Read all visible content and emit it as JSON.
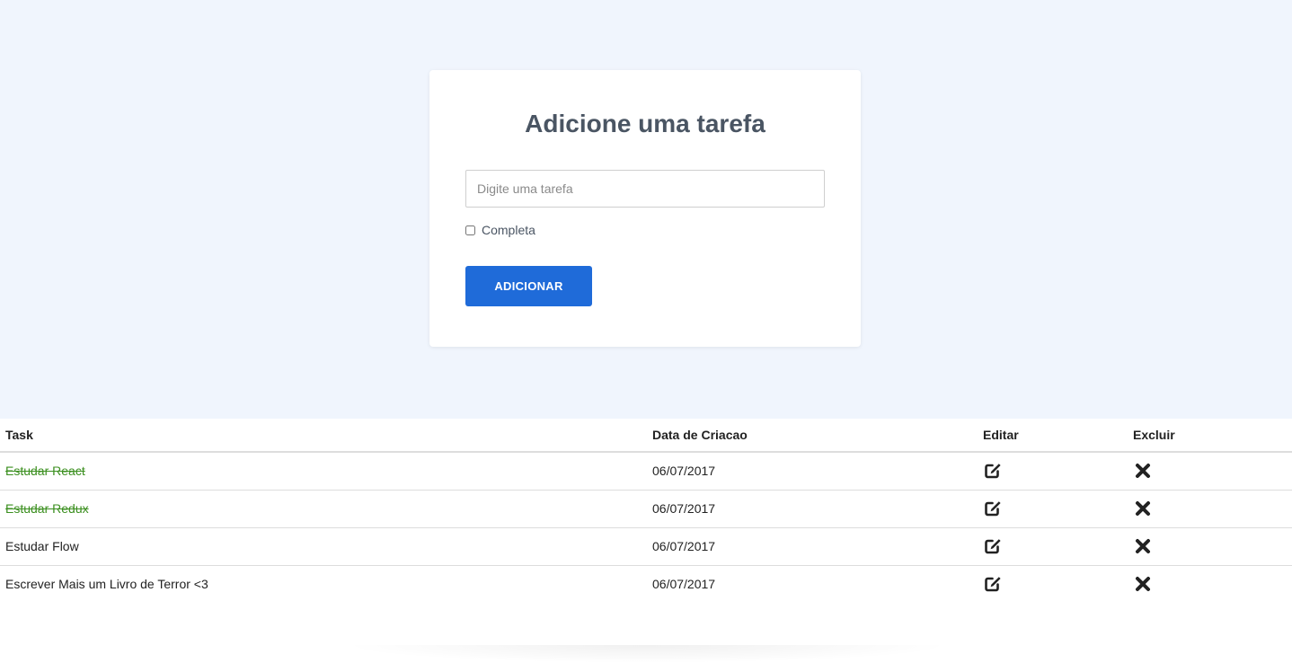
{
  "form": {
    "title": "Adicione uma tarefa",
    "input_placeholder": "Digite uma tarefa",
    "input_value": "",
    "checkbox_label": "Completa",
    "checkbox_checked": false,
    "submit_label": "ADICIONAR"
  },
  "table": {
    "headers": {
      "task": "Task",
      "date": "Data de Criacao",
      "edit": "Editar",
      "delete": "Excluir"
    },
    "rows": [
      {
        "task": "Estudar React",
        "date": "06/07/2017",
        "completed": true
      },
      {
        "task": "Estudar Redux",
        "date": "06/07/2017",
        "completed": true
      },
      {
        "task": "Estudar Flow",
        "date": "06/07/2017",
        "completed": false
      },
      {
        "task": "Escrever Mais um Livro de Terror <3",
        "date": "06/07/2017",
        "completed": false
      }
    ]
  },
  "icons": {
    "edit": "edit-icon",
    "delete": "close-icon"
  },
  "colors": {
    "accent": "#1f6bd9",
    "completed_text": "#3b8f1f",
    "background": "#f0f5fd"
  }
}
